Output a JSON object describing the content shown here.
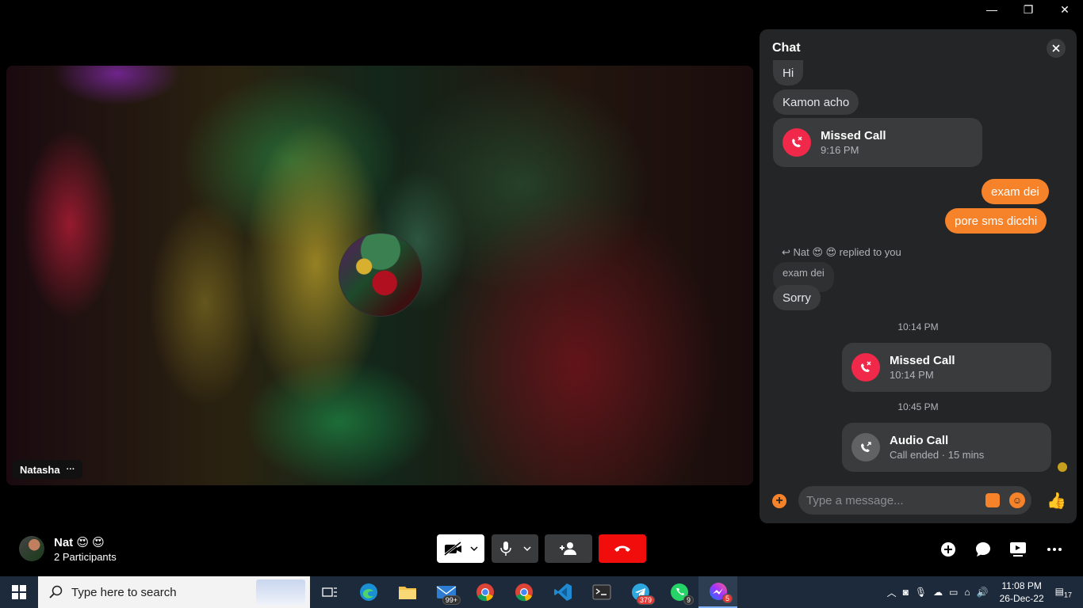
{
  "window": {
    "minimize": "—",
    "restore": "❐",
    "close": "✕"
  },
  "video": {
    "participant_name": "Natasha",
    "more": "···"
  },
  "chat": {
    "title": "Chat",
    "messages": [
      {
        "text": "Hi"
      },
      {
        "text": "Kamon acho"
      },
      {
        "text": "exam dei"
      },
      {
        "text": "pore sms dicchi"
      }
    ],
    "missed_call_1": {
      "title": "Missed Call",
      "time": "9:16 PM"
    },
    "reply_header": "Nat 😍 😍 replied to you",
    "quoted_text": "exam dei",
    "reply_text": "Sorry",
    "stamp_1": "10:14 PM",
    "missed_call_2": {
      "title": "Missed Call",
      "time": "10:14 PM"
    },
    "stamp_2": "10:45 PM",
    "audio_call": {
      "title": "Audio Call",
      "sub": "Call ended · 15 mins"
    },
    "composer_placeholder": "Type a message...",
    "accent_color": "#f6822a"
  },
  "call_bar": {
    "name": "Nat 😍 😍",
    "participants": "2 Participants"
  },
  "taskbar": {
    "search_placeholder": "Type here to search",
    "mail_badge": "99+",
    "telegram_badge": "379",
    "whatsapp_badge": "9",
    "messenger_badge": "5",
    "time": "11:08 PM",
    "date": "26-Dec-22",
    "notif_count": "17"
  }
}
